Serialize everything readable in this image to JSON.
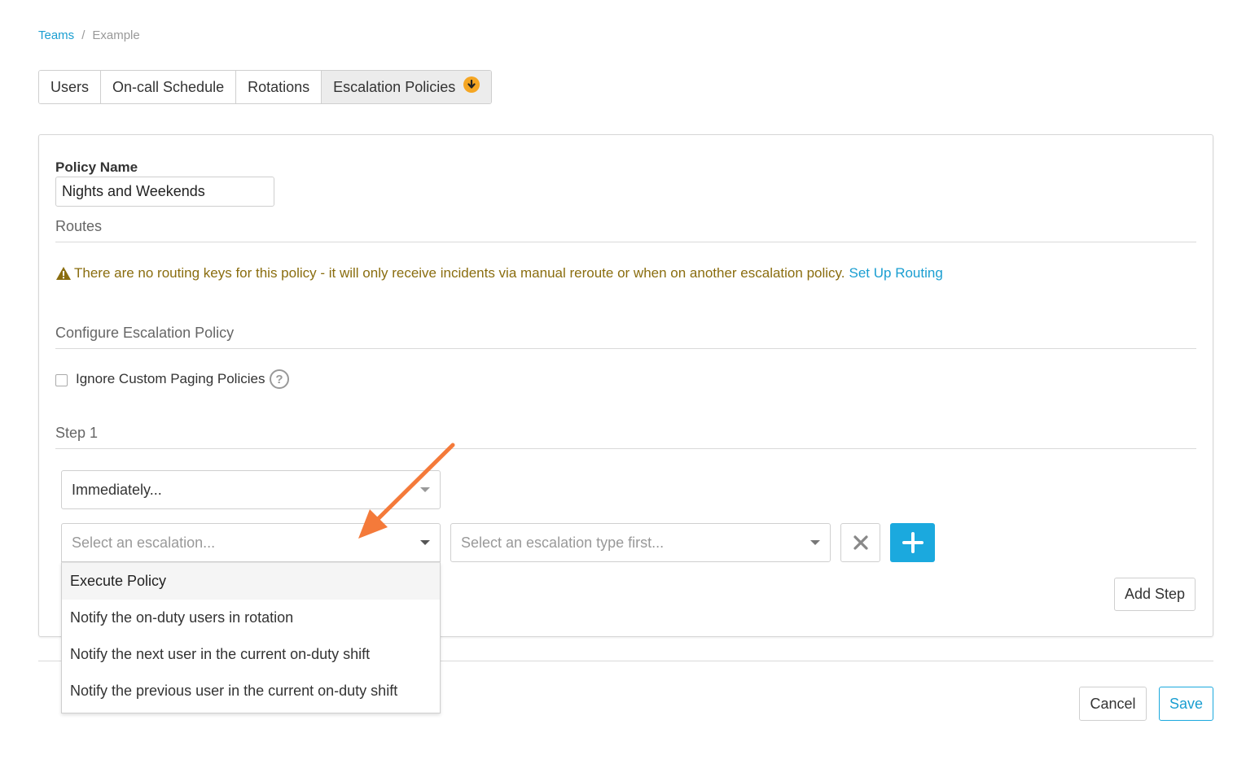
{
  "breadcrumb": {
    "link": "Teams",
    "separator": "/",
    "current": "Example"
  },
  "tabs": [
    {
      "label": "Users"
    },
    {
      "label": "On-call Schedule"
    },
    {
      "label": "Rotations"
    },
    {
      "label": "Escalation Policies"
    }
  ],
  "policy": {
    "name_label": "Policy Name",
    "name_value": "Nights and Weekends"
  },
  "routes": {
    "title": "Routes",
    "warning": "There are no routing keys for this policy - it will only receive incidents via manual reroute or when on another escalation policy.",
    "link": "Set Up Routing"
  },
  "configure": {
    "title": "Configure Escalation Policy",
    "checkbox_label": "Ignore Custom Paging Policies",
    "help": "?"
  },
  "step": {
    "title": "Step 1",
    "timing_value": "Immediately...",
    "escalation_placeholder": "Select an escalation...",
    "type_placeholder": "Select an escalation type first...",
    "menu_items": [
      "Execute Policy",
      "Notify the on-duty users in rotation",
      "Notify the next user in the current on-duty shift",
      "Notify the previous user in the current on-duty shift"
    ],
    "add_step": "Add Step"
  },
  "footer": {
    "cancel": "Cancel",
    "save": "Save"
  },
  "colors": {
    "accent": "#1ba9de",
    "warning": "#8a6d0f",
    "badge": "#f5a623",
    "annotation_arrow": "#f47a3a"
  }
}
